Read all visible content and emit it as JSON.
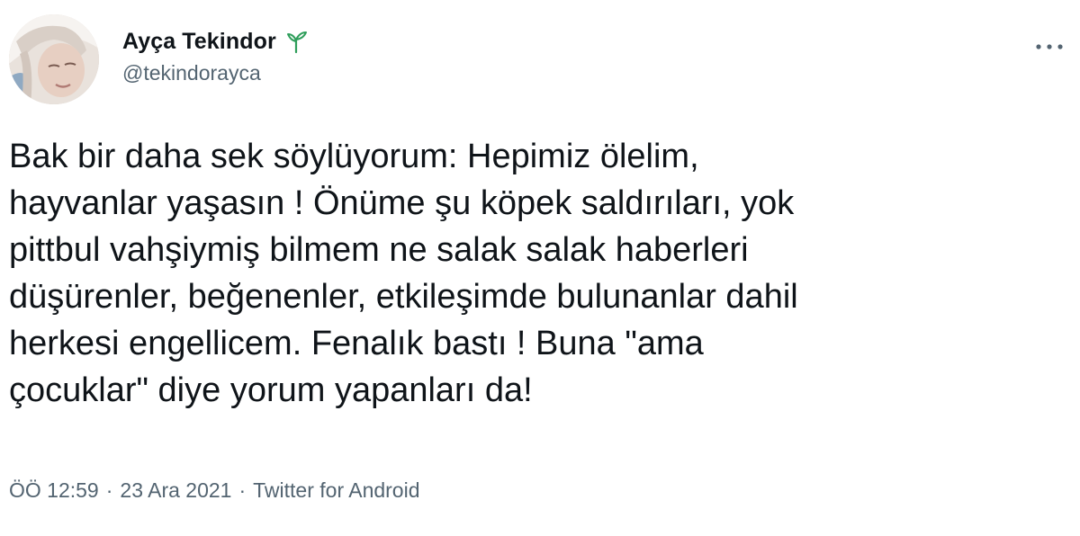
{
  "author": {
    "display_name": "Ayça Tekindor",
    "handle": "@tekindorayca",
    "badge_icon": "sprout-icon"
  },
  "tweet": {
    "text": "Bak bir daha sek söylüyorum: Hepimiz ölelim,\nhayvanlar yaşasın ! Önüme şu köpek saldırıları, yok\npittbul vahşiymiş bilmem ne salak salak haberleri\ndüşürenler, beğenenler, etkileşimde bulunanlar dahil\nherkesi engellicem. Fenalık bastı ! Buna \"ama\nçocuklar\" diye yorum yapanları da!",
    "time": "ÖÖ 12:59",
    "separator": "·",
    "date": "23 Ara 2021",
    "source": "Twitter for Android"
  },
  "colors": {
    "text_primary": "#0f1419",
    "text_secondary": "#536471",
    "sprout": "#2f9e5b"
  }
}
